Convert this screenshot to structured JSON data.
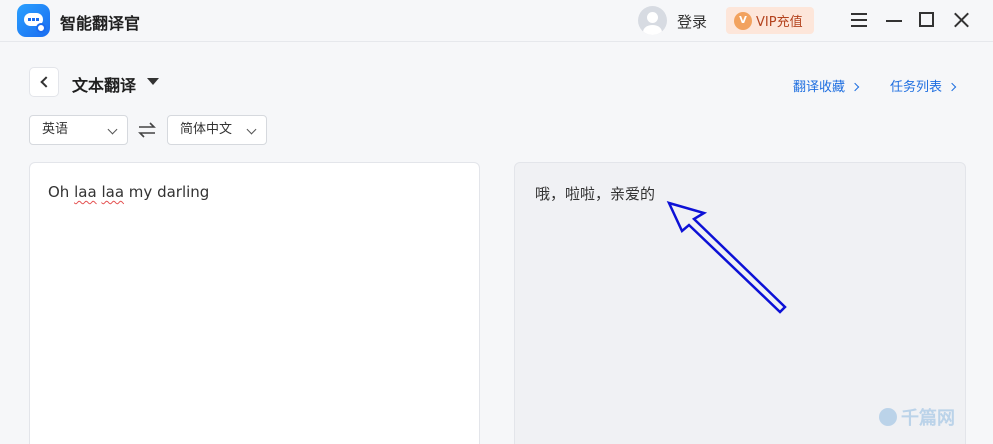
{
  "app": {
    "title": "智能翻译官"
  },
  "header": {
    "login_label": "登录",
    "vip_label": "VIP充值",
    "vip_icon_letter": "V"
  },
  "toolbar": {
    "mode_label": "文本翻译",
    "favorites_label": "翻译收藏",
    "tasks_label": "任务列表"
  },
  "languages": {
    "source": "英语",
    "target": "简体中文"
  },
  "source_panel": {
    "words": [
      "Oh",
      "laa",
      "laa",
      "my",
      "darling"
    ]
  },
  "target_panel": {
    "text": "哦，啦啦，亲爱的"
  },
  "watermark": {
    "text": "千篇网"
  },
  "colors": {
    "accent": "#1f6fe0",
    "vip_bg": "#fde6da",
    "annotation_arrow": "#0d11d6"
  },
  "icons": {
    "logo": "chat-bubble-icon",
    "swap": "swap-arrows-icon",
    "back": "chevron-left-icon"
  }
}
